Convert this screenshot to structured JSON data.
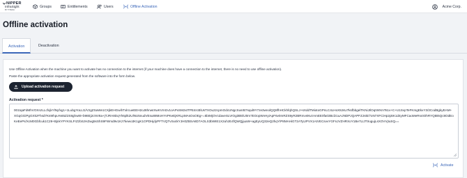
{
  "app": {
    "brand_line1": "NIPPER",
    "brand_line2": "InfraSight",
    "brand_line3": "BY TITANIA"
  },
  "nav": {
    "items": [
      {
        "label": "Groups",
        "icon": "groups-icon"
      },
      {
        "label": "Entitlements",
        "icon": "entitlements-icon"
      },
      {
        "label": "Users",
        "icon": "users-icon"
      },
      {
        "label": "Offline Activation",
        "icon": "offline-activation-icon",
        "active": true
      }
    ],
    "account": "Acme Corp."
  },
  "page": {
    "title": "Offline activation"
  },
  "tabs": [
    {
      "label": "Activation",
      "active": true
    },
    {
      "label": "Deactivation",
      "active": false
    }
  ],
  "main": {
    "description1": "Use Offline Activation when the machine you want to activate has no connection to the internet (if your machine does have a connection to the internet, there is no need to use offline activation).",
    "description2": "Paste the appropriate activation request generated from the software into the form below.",
    "upload_label": "Upload activation request",
    "request_label": "Activation request *",
    "request_value": "001tqaFdMhVOXnzLLcfxjkYlNyfxg1+1LubgYoLLt1/VzgZSaWe1CXjkEHGwihTxlrcueEEH2oJ8hnwIXwKVmGv1oAPxSM2xtTPE4rcBlUsTXOu2zcpmOdcUNgcSusrB7squl9Y7ze3wnolQQ8fhHCkhfqhQSLJ+sXddTMiotoGPnLC4LHoX8JsU7ksfbbgelTKNiJIlOqIWXmTs1v+C+U1SvpTeFKmgEkxY3/2CodBgkyEAM+XGqGGiPgGXkzFhsd7Ks9Ihpu%65Z2S8ghw8t+b98Ej2cNV8a+jTJRA8DqYh6plk2UlNU5nudVEsu88MoHYsPKeEjKRLpMAsOoOEg+=5bIMjOVcdaveSLVrOg3B5hJ0m7EOopWvHyiApF6v0mRZS9yR2BRmvsNvzAmEE0fa03Bclz1uAJNDPJQAPFZJstk/7oN7XFCiHp2pkK1d4yMFCaoMeRs4IOhRYQtB5Qc8OdEoKeEePs/XcM0Gbfcuk1C29+BjnkYPYKSLFrZzbSzHZwg5sShS9FWmd9v1Kz7kewo3K1gK1OPDHjdyPFTVQTvSx4kYJH0ZBSA8D7AOLS3bWIE1X2uhzE4fQWQjjuaW+agEyUQ32eQ2hqY/P8MAHiGT2ATyUPVX1AtVECsvvYGFnJVZHRXoY1Be7LIJTtrugujLsXOVVjIuSQ=="
  },
  "footer": {
    "activate_label": "Activate"
  },
  "colors": {
    "accent": "#3a66b8",
    "button_dark": "#1c2330",
    "background": "#f1f3f6"
  }
}
